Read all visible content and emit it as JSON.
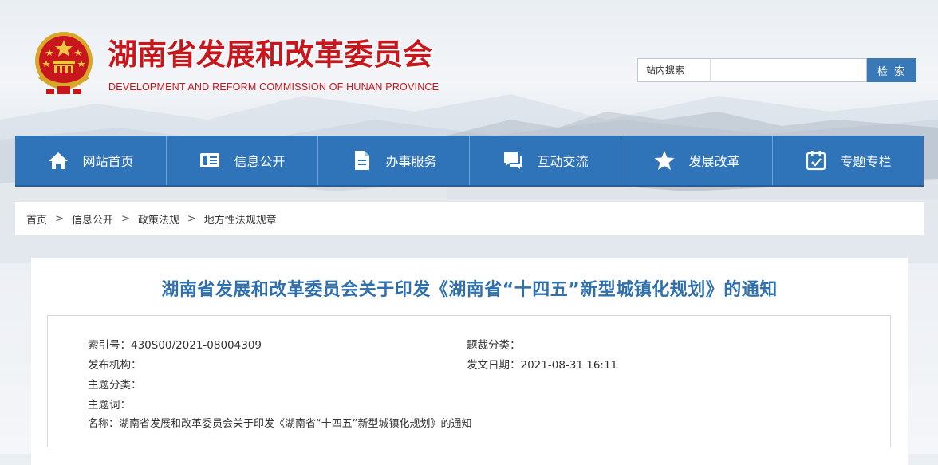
{
  "header": {
    "title": "湖南省发展和改革委员会",
    "subtitle": "DEVELOPMENT AND REFORM COMMISSION OF HUNAN PROVINCE"
  },
  "search": {
    "label": "站内搜索",
    "value": "",
    "button": "检 索"
  },
  "nav": {
    "items": [
      {
        "label": "网站首页",
        "icon": "home-icon"
      },
      {
        "label": "信息公开",
        "icon": "document-list-icon"
      },
      {
        "label": "办事服务",
        "icon": "file-icon"
      },
      {
        "label": "互动交流",
        "icon": "chat-icon"
      },
      {
        "label": "发展改革",
        "icon": "star-icon"
      },
      {
        "label": "专题专栏",
        "icon": "calendar-check-icon"
      }
    ]
  },
  "breadcrumb": {
    "items": [
      "首页",
      "信息公开",
      "政策法规",
      "地方性法规规章"
    ],
    "separator": ">"
  },
  "article": {
    "title": "湖南省发展和改革委员会关于印发《湖南省“十四五”新型城镇化规划》的通知",
    "meta": {
      "index": "索引号：430S00/2021-08004309",
      "category": "题裁分类：",
      "publisher": "发布机构：",
      "date": "发文日期：2021-08-31 16:11",
      "topic": "主题分类：",
      "keywords": "主题词：",
      "name": "名称：湖南省发展和改革委员会关于印发《湖南省“十四五”新型城镇化规划》的通知"
    }
  },
  "colors": {
    "brand_red": "#c8161d",
    "nav_blue": "#2f74b8",
    "title_blue": "#2e6fae"
  }
}
